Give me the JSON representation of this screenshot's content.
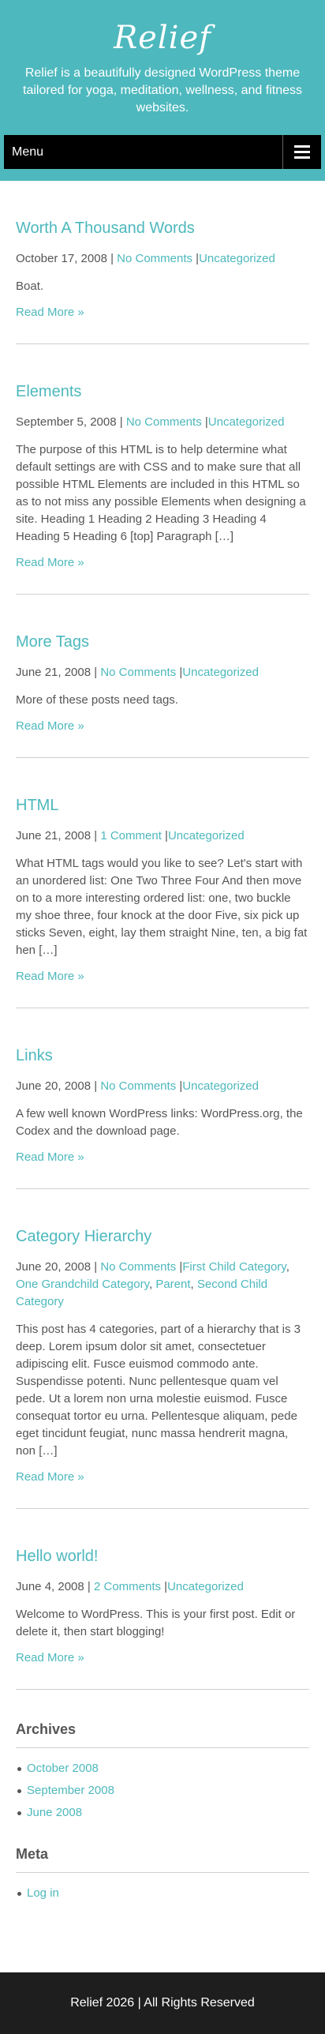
{
  "header": {
    "title": "Relief",
    "description": "Relief is a beautifully designed WordPress theme tailored for yoga, meditation, wellness, and fitness websites.",
    "menu_label": "Menu",
    "menu_icon": "hamburger-icon"
  },
  "posts": [
    {
      "title": "Worth A Thousand Words",
      "date": "October 17, 2008",
      "comments": "No Comments",
      "categories": [
        "Uncategorized"
      ],
      "excerpt": "Boat.",
      "read_more": "Read More »"
    },
    {
      "title": "Elements",
      "date": "September 5, 2008",
      "comments": "No Comments",
      "categories": [
        "Uncategorized"
      ],
      "excerpt": "The purpose of this HTML is to help determine what default settings are with CSS and to make sure that all possible HTML Elements are included in this HTML so as to not miss any possible Elements when designing a site. Heading 1 Heading 2 Heading 3 Heading 4 Heading 5 Heading 6 [top] Paragraph […]",
      "read_more": "Read More »"
    },
    {
      "title": "More Tags",
      "date": "June 21, 2008",
      "comments": "No Comments",
      "categories": [
        "Uncategorized"
      ],
      "excerpt": "More of these posts need tags.",
      "read_more": "Read More »"
    },
    {
      "title": "HTML",
      "date": "June 21, 2008",
      "comments": "1 Comment",
      "categories": [
        "Uncategorized"
      ],
      "excerpt": "What HTML tags would you like to see? Let's start with an unordered list: One Two Three Four And then move on to a more interesting ordered list: one, two buckle my shoe three, four knock at the door Five, six pick up sticks Seven, eight, lay them straight Nine, ten, a big fat hen […]",
      "read_more": "Read More »"
    },
    {
      "title": "Links",
      "date": "June 20, 2008",
      "comments": "No Comments",
      "categories": [
        "Uncategorized"
      ],
      "excerpt": "A few well known WordPress links: WordPress.org, the Codex and the download page.",
      "read_more": "Read More »"
    },
    {
      "title": "Category Hierarchy",
      "date": "June 20, 2008",
      "comments": "No Comments",
      "categories": [
        "First Child Category",
        "One Grandchild Category",
        "Parent",
        "Second Child Category"
      ],
      "excerpt": "This post has 4 categories, part of a hierarchy that is 3 deep. Lorem ipsum dolor sit amet, consectetuer adipiscing elit. Fusce euismod commodo ante. Suspendisse potenti. Nunc pellentesque quam vel pede. Ut a lorem non urna molestie euismod. Fusce consequat tortor eu urna. Pellentesque aliquam, pede eget tincidunt feugiat, nunc massa hendrerit magna, non […]",
      "read_more": "Read More »"
    },
    {
      "title": "Hello world!",
      "date": "June 4, 2008",
      "comments": "2 Comments",
      "categories": [
        "Uncategorized"
      ],
      "excerpt": "Welcome to WordPress. This is your first post. Edit or delete it, then start blogging!",
      "read_more": "Read More »"
    }
  ],
  "sidebar": {
    "archives": {
      "title": "Archives",
      "items": [
        "October 2008",
        "September 2008",
        "June 2008"
      ]
    },
    "meta": {
      "title": "Meta",
      "items": [
        "Log in"
      ]
    }
  },
  "footer": {
    "text": "Relief 2026 | All Rights Reserved"
  },
  "colors": {
    "accent": "#4db8bd",
    "nav_background": "#000000",
    "footer_background": "#1e1e1e",
    "text": "#555555"
  }
}
